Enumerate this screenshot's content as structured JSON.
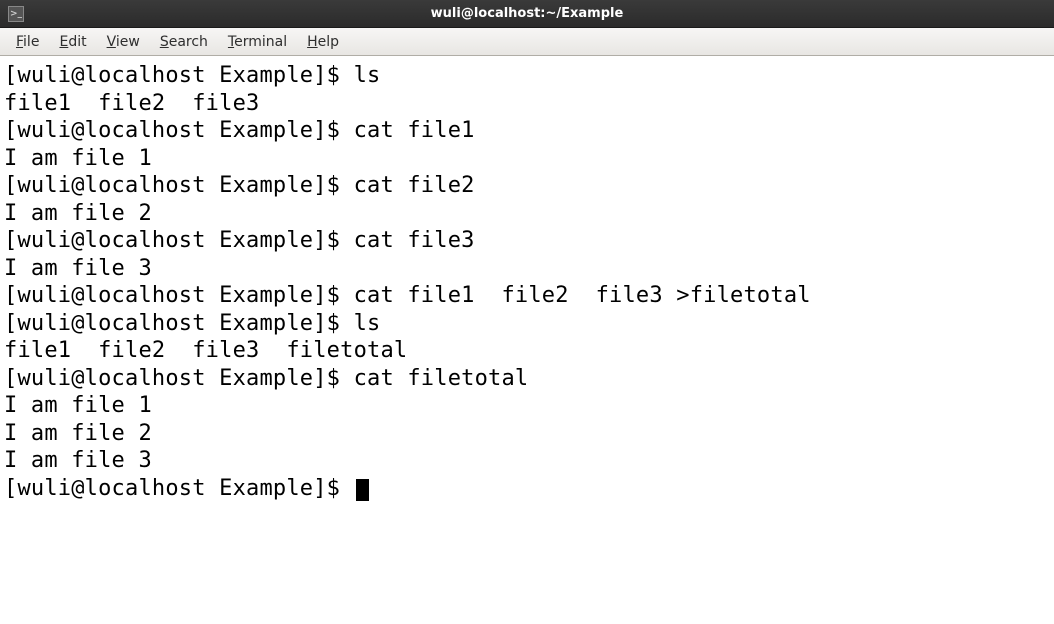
{
  "titlebar": {
    "title": "wuli@localhost:~/Example",
    "icon_glyph": ">_"
  },
  "menubar": {
    "items": [
      {
        "accel": "F",
        "rest": "ile"
      },
      {
        "accel": "E",
        "rest": "dit"
      },
      {
        "accel": "V",
        "rest": "iew"
      },
      {
        "accel": "S",
        "rest": "earch"
      },
      {
        "accel": "T",
        "rest": "erminal"
      },
      {
        "accel": "H",
        "rest": "elp"
      }
    ]
  },
  "session": {
    "prompt": "[wuli@localhost Example]$ ",
    "lines": [
      {
        "type": "cmd",
        "text": "ls"
      },
      {
        "type": "output",
        "text": "file1  file2  file3"
      },
      {
        "type": "cmd",
        "text": "cat file1"
      },
      {
        "type": "output",
        "text": "I am file 1"
      },
      {
        "type": "cmd",
        "text": "cat file2"
      },
      {
        "type": "output",
        "text": "I am file 2"
      },
      {
        "type": "cmd",
        "text": "cat file3"
      },
      {
        "type": "output",
        "text": "I am file 3"
      },
      {
        "type": "cmd",
        "text": "cat file1  file2  file3 >filetotal"
      },
      {
        "type": "cmd",
        "text": "ls"
      },
      {
        "type": "output",
        "text": "file1  file2  file3  filetotal"
      },
      {
        "type": "cmd",
        "text": "cat filetotal"
      },
      {
        "type": "output",
        "text": "I am file 1"
      },
      {
        "type": "output",
        "text": "I am file 2"
      },
      {
        "type": "output",
        "text": "I am file 3"
      },
      {
        "type": "prompt_cursor"
      }
    ]
  }
}
